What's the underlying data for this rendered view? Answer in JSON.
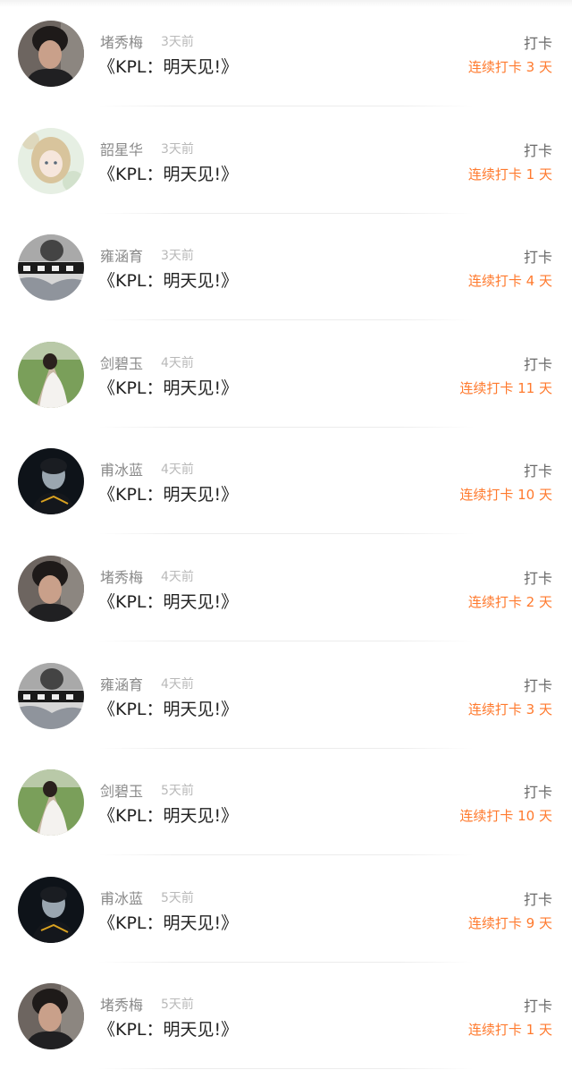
{
  "feed": {
    "items": [
      {
        "name": "堵秀梅",
        "time": "3天前",
        "title": "《KPL：明天见!》",
        "action": "打卡",
        "streak": "连续打卡 3 天",
        "avatar": "avatar-man-dark"
      },
      {
        "name": "韶星华",
        "time": "3天前",
        "title": "《KPL：明天见!》",
        "action": "打卡",
        "streak": "连续打卡 1 天",
        "avatar": "avatar-anime-girl"
      },
      {
        "name": "雍涵育",
        "time": "3天前",
        "title": "《KPL：明天见!》",
        "action": "打卡",
        "streak": "连续打卡 4 天",
        "avatar": "avatar-mono-text"
      },
      {
        "name": "剑碧玉",
        "time": "4天前",
        "title": "《KPL：明天见!》",
        "action": "打卡",
        "streak": "连续打卡 11 天",
        "avatar": "avatar-wedding-couple"
      },
      {
        "name": "甫冰蓝",
        "time": "4天前",
        "title": "《KPL：明天见!》",
        "action": "打卡",
        "streak": "连续打卡 10 天",
        "avatar": "avatar-dark-portrait"
      },
      {
        "name": "堵秀梅",
        "time": "4天前",
        "title": "《KPL：明天见!》",
        "action": "打卡",
        "streak": "连续打卡 2 天",
        "avatar": "avatar-man-dark"
      },
      {
        "name": "雍涵育",
        "time": "4天前",
        "title": "《KPL：明天见!》",
        "action": "打卡",
        "streak": "连续打卡 3 天",
        "avatar": "avatar-mono-text"
      },
      {
        "name": "剑碧玉",
        "time": "5天前",
        "title": "《KPL：明天见!》",
        "action": "打卡",
        "streak": "连续打卡 10 天",
        "avatar": "avatar-wedding-couple"
      },
      {
        "name": "甫冰蓝",
        "time": "5天前",
        "title": "《KPL：明天见!》",
        "action": "打卡",
        "streak": "连续打卡 9 天",
        "avatar": "avatar-dark-portrait"
      },
      {
        "name": "堵秀梅",
        "time": "5天前",
        "title": "《KPL：明天见!》",
        "action": "打卡",
        "streak": "连续打卡 1 天",
        "avatar": "avatar-man-dark"
      }
    ]
  },
  "colors": {
    "accent": "#ff7a2e",
    "name": "#8a8a8a",
    "time": "#b9b9b9",
    "title": "#222222"
  }
}
